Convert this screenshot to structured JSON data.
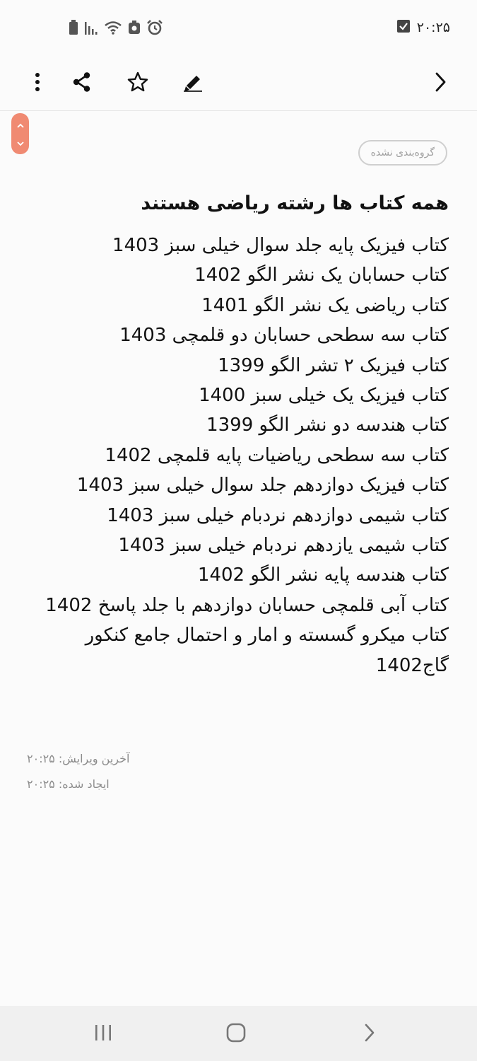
{
  "status_bar": {
    "time": "۲۰:۲۵",
    "icons": [
      "battery-icon",
      "signal-icon",
      "wifi-icon",
      "data-saver-icon",
      "alarm-icon",
      "checkbox-notification-icon"
    ]
  },
  "toolbar": {
    "icons": [
      "more-vert-icon",
      "share-icon",
      "star-icon",
      "edit-icon",
      "chevron-right-icon"
    ]
  },
  "note": {
    "category": "گروه‌بندی نشده",
    "title": "همه کتاب ها رشته ریاضی هستند",
    "lines": [
      "کتاب فیزیک پایه جلد سوال خیلی سبز 1403",
      "کتاب حسابان یک نشر الگو 1402",
      "کتاب ریاضی یک نشر الگو 1401",
      "کتاب سه سطحی حسابان دو قلمچی 1403",
      "کتاب فیزیک ۲ تشر الگو 1399",
      "کتاب فیزیک یک خیلی سبز 1400",
      "کتاب هندسه دو نشر الگو 1399",
      "کتاب سه سطحی ریاضیات پایه قلمچی 1402",
      "کتاب فیزیک دوازدهم جلد سوال خیلی سبز 1403",
      "کتاب شیمی دوازدهم نردبام خیلی سبز 1403",
      "کتاب شیمی یازدهم نردبام خیلی سبز 1403",
      "کتاب هندسه پایه نشر الگو 1402",
      "کتاب آبی قلمچی حسابان دوازدهم با جلد پاسخ 1402",
      "کتاب میکرو گسسته و امار و احتمال جامع کنکور",
      "گاج1402"
    ]
  },
  "meta": {
    "last_edited": "آخرین ویرایش: ۲۰:۲۵",
    "created": "ایجاد شده: ۲۰:۲۵"
  },
  "colors": {
    "accent": "#f08a72",
    "background": "#fbfbfb",
    "text": "#111111",
    "muted": "#8c8c8c"
  }
}
